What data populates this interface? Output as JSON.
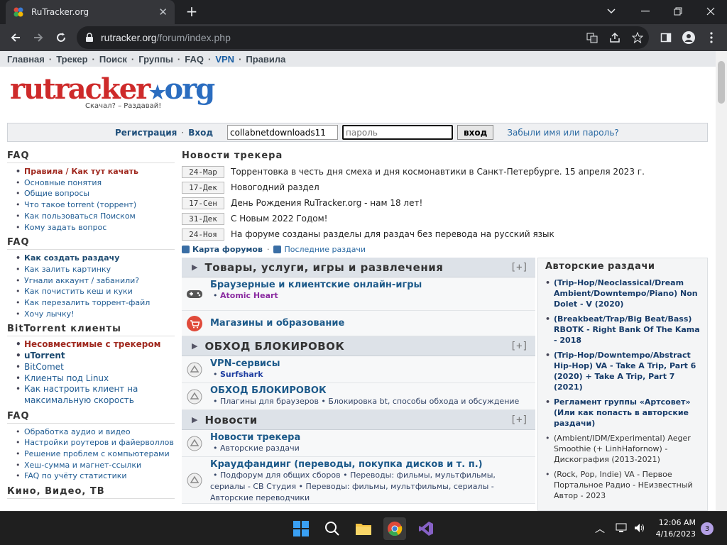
{
  "browser": {
    "tab_title": "RuTracker.org",
    "url_host": "rutracker.org",
    "url_path": "/forum/index.php"
  },
  "topnav": [
    "Главная",
    "Трекер",
    "Поиск",
    "Группы",
    "FAQ",
    "VPN",
    "Правила"
  ],
  "logo": {
    "text_a": "rutracker",
    "text_b": "org",
    "slogan": "Скачал? – Раздавай!"
  },
  "login": {
    "register": "Регистрация",
    "login_link": "Вход",
    "username_value": "collabnetdownloads11",
    "password_placeholder": "пароль",
    "submit": "вход",
    "forgot": "Забыли имя или пароль?"
  },
  "sidebar": {
    "faq1": {
      "title": "FAQ",
      "items_head": [
        "Правила",
        "Как тут качать"
      ],
      "items": [
        "Основные понятия",
        "Общие вопросы",
        "Что такое torrent (торрент)",
        "Как пользоваться Поиском",
        "Кому задать вопрос"
      ]
    },
    "faq2": {
      "title": "FAQ",
      "items": [
        "Как создать раздачу",
        "Как залить картинку",
        "Угнали аккаунт / забанили?",
        "Как почистить кеш и куки",
        "Как перезалить торрент-файл",
        "Хочу лычку!"
      ]
    },
    "bt": {
      "title": "BitTorrent клиенты",
      "items": [
        "Несовместимые с трекером",
        "uTorrent",
        "BitComet",
        "Клиенты под Linux",
        "Как настроить клиент на максимальную скорость"
      ]
    },
    "faq3": {
      "title": "FAQ",
      "items": [
        "Обработка аудио и видео",
        "Настройки роутеров и файерволлов",
        "Решение проблем с компьютерами",
        "Хеш-сумма и магнет-ссылки",
        "FAQ по учёту статистики"
      ]
    },
    "cut": "Кино, Видео, ТВ"
  },
  "news": {
    "title": "Новости трекера",
    "rows": [
      {
        "date": "24-Мар",
        "text": "Торрентовка в честь дня смеха и дня космонавтики в Санкт-Петербурге. 15 апреля 2023 г."
      },
      {
        "date": "17-Дек",
        "text": "Новогодний раздел"
      },
      {
        "date": "17-Сен",
        "text": "День Рождения RuTracker.org - нам 18 лет!"
      },
      {
        "date": "31-Дек",
        "text": "С Новым 2022 Годом!"
      },
      {
        "date": "24-Ноя",
        "text": "На форуме созданы разделы для раздач без перевода на русский язык"
      }
    ]
  },
  "links": {
    "map": "Карта форумов",
    "latest": "Последние раздачи"
  },
  "categories": {
    "c1": {
      "title": "Товары, услуги, игры и развлечения",
      "plus": "[+]",
      "f1": {
        "name": "Браузерные и клиентские онлайн-игры",
        "sub": "Atomic Heart"
      },
      "f2": {
        "name": "Магазины и образование"
      }
    },
    "c2": {
      "title": "ОБХОД БЛОКИРОВОК",
      "plus": "[+]",
      "f1": {
        "name": "VPN-сервисы",
        "sub": "Surfshark"
      },
      "f2": {
        "name": "ОБХОД БЛОКИРОВОК",
        "sub1": "Плагины для браузеров",
        "sub2": "Блокировка bt, способы обхода и обсуждение"
      }
    },
    "c3": {
      "title": "Новости",
      "plus": "[+]",
      "f1": {
        "name": "Новости трекера",
        "sub": "Авторские раздачи"
      },
      "f2": {
        "name": "Краудфандинг (переводы, покупка дисков и т. п.)",
        "sub1": "Подфорум для общих сборов",
        "sub2": "Переводы: фильмы, мультфильмы, сериалы - СВ Студия",
        "sub3": "Переводы: фильмы, мультфильмы, сериалы - Авторские переводчики"
      }
    }
  },
  "author": {
    "title": "Авторские раздачи",
    "items": [
      "(Trip-Hop/Neoclassical/Dream Ambient/Downtempo/Piano) Non Dolet - V (2020)",
      "(Breakbeat/Trap/Big Beat/Bass) RBOTK - Right Bank Of The Kama - 2018",
      "(Trip-Hop/Downtempo/Abstract Hip-Hop) VA - Take A Trip, Part 6 (2020) + Take A Trip, Part 7 (2021)",
      "Регламент группы «Артсовет» (Или как попасть в авторские раздачи)",
      "(Ambient/IDM/Experimental) Aeger Smoothie (+ LinhHafornow) - Дискография (2013-2021)",
      "(Rock, Pop, Indie) VA - Первое Портальное Радио - НЕизвестный Автор - 2023"
    ]
  },
  "taskbar": {
    "time": "12:06 AM",
    "date": "4/16/2023",
    "badge": "3"
  }
}
